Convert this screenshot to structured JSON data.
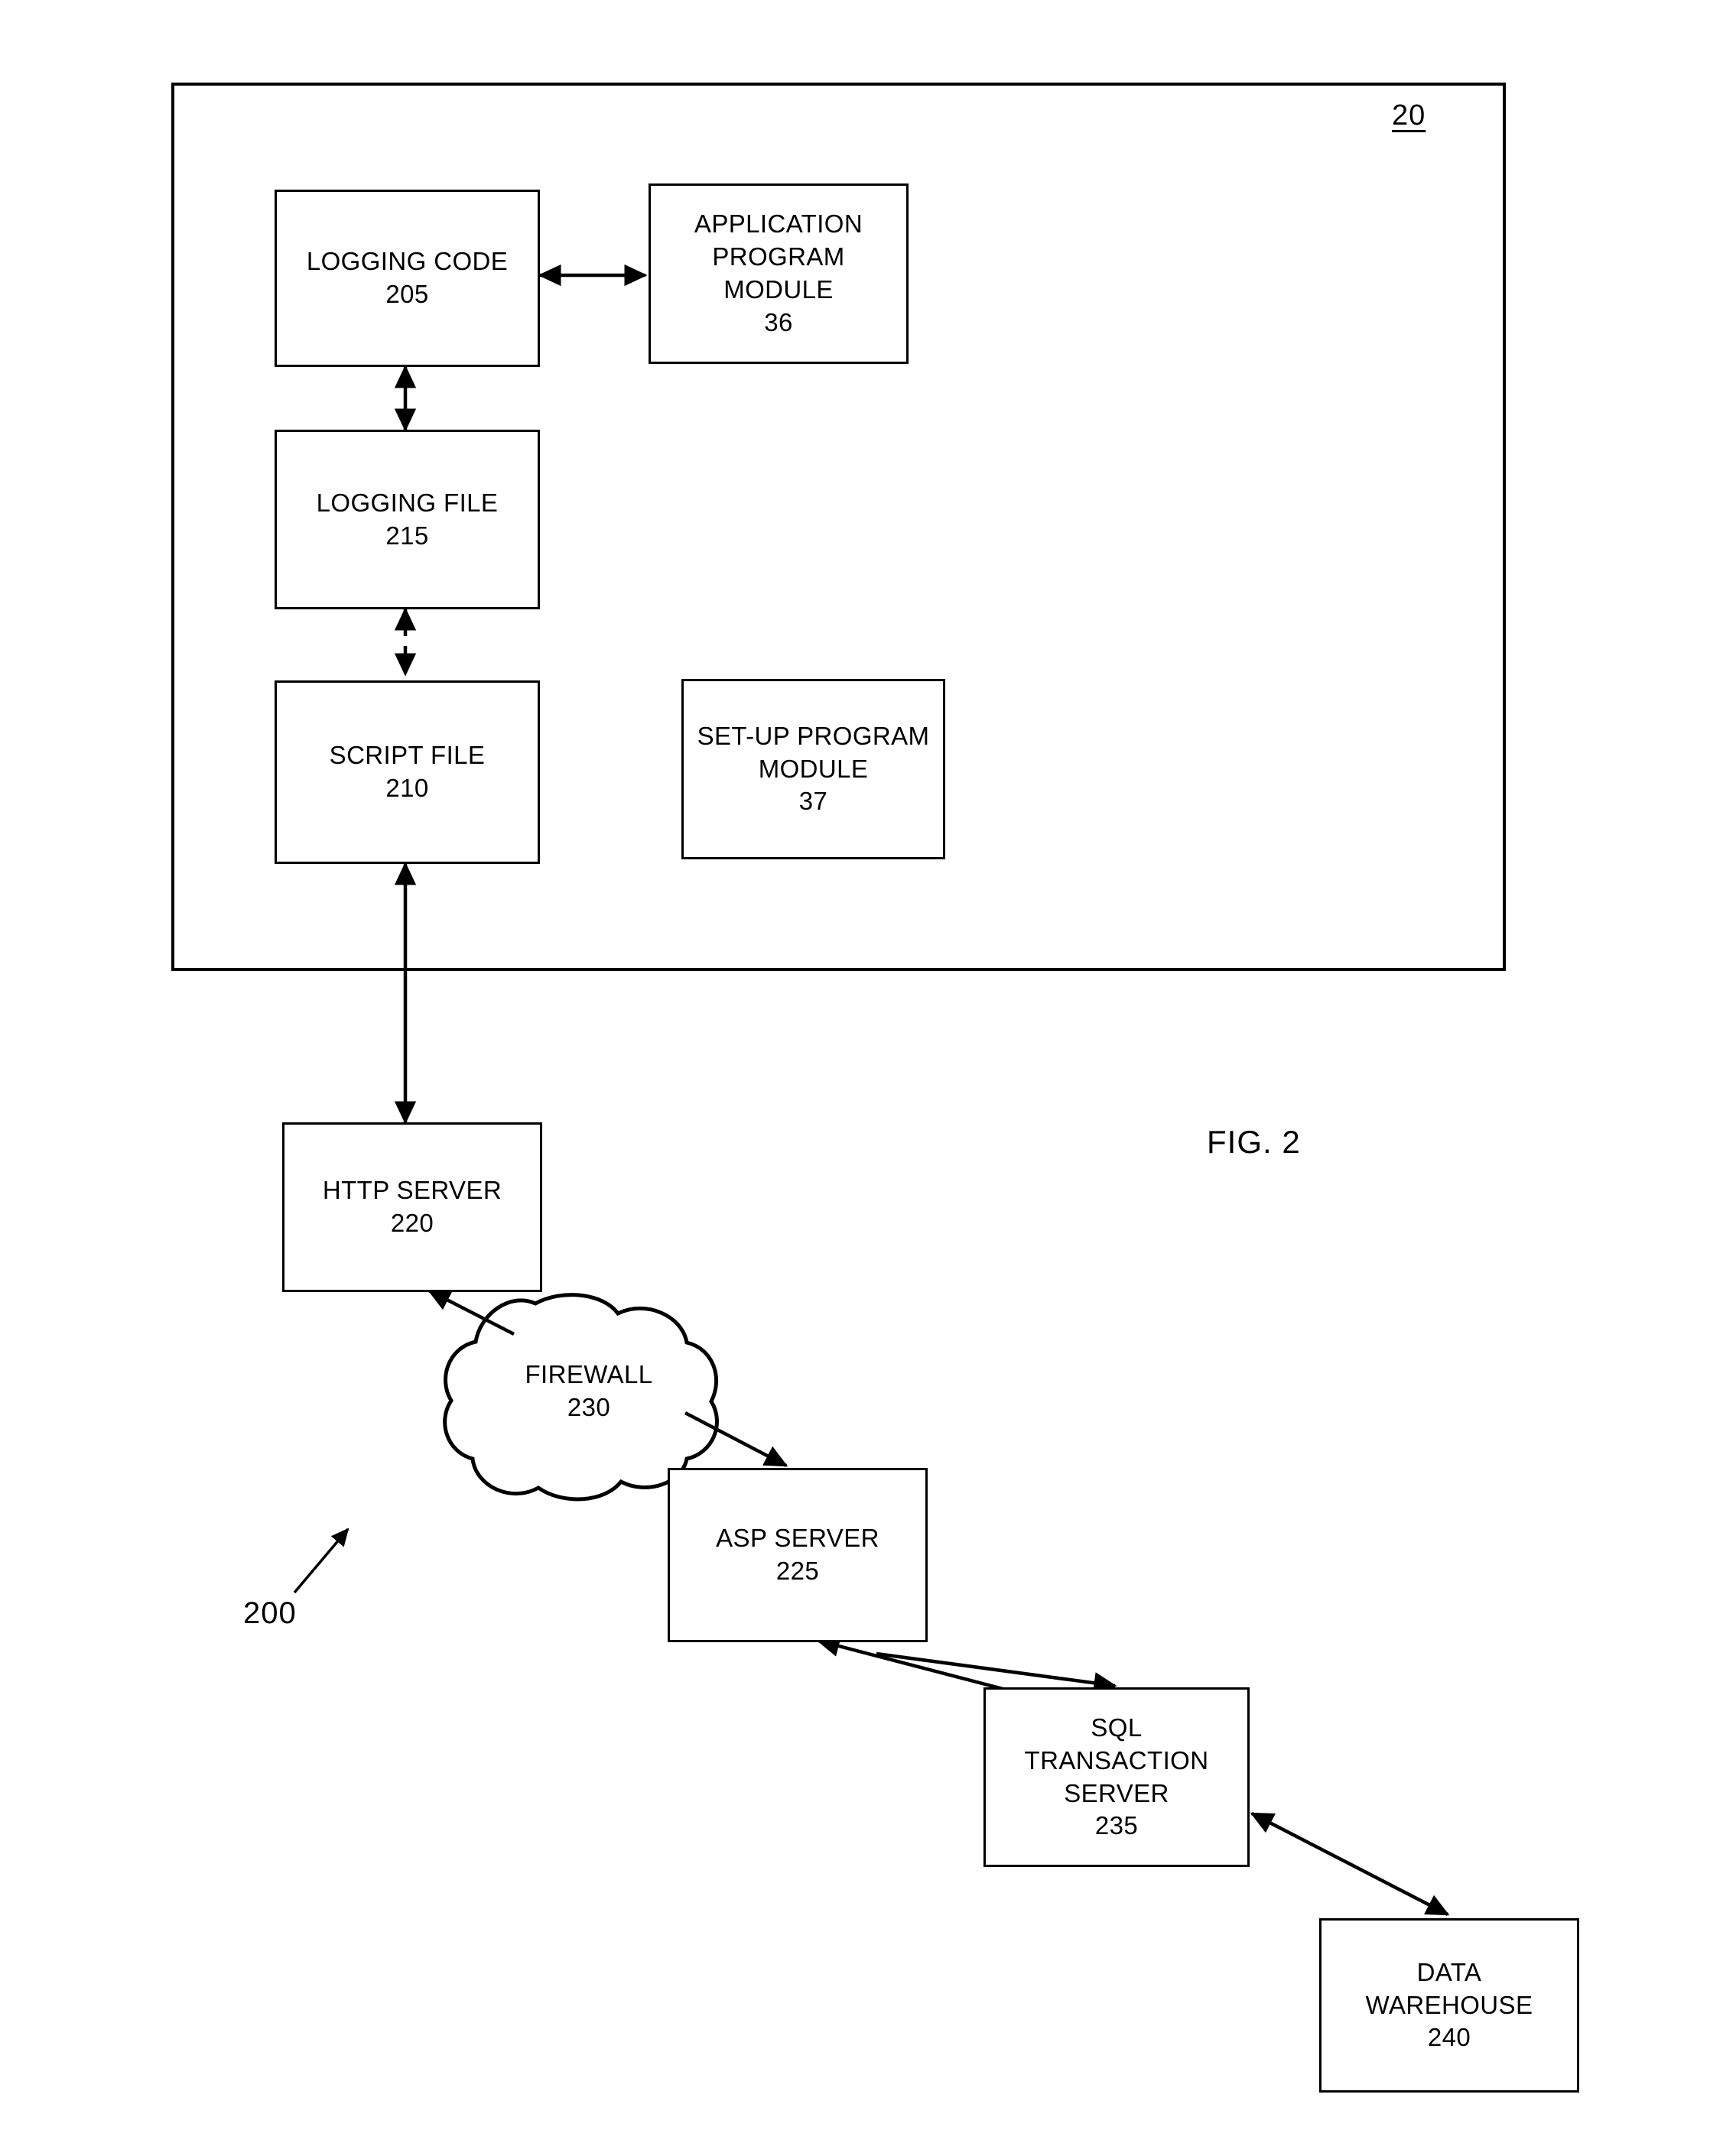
{
  "figure": {
    "caption": "FIG. 2",
    "system_reference": "200",
    "container_reference": "20"
  },
  "nodes": [
    {
      "id": "logging-code",
      "label": "LOGGING CODE",
      "reference": "205",
      "text": "LOGGING CODE\n205",
      "shape": "rectangle"
    },
    {
      "id": "application-program-module",
      "label": "APPLICATION PROGRAM MODULE",
      "reference": "36",
      "text": "APPLICATION\nPROGRAM\nMODULE\n36",
      "shape": "rectangle"
    },
    {
      "id": "logging-file",
      "label": "LOGGING FILE",
      "reference": "215",
      "text": "LOGGING FILE\n215",
      "shape": "rectangle"
    },
    {
      "id": "script-file",
      "label": "SCRIPT FILE",
      "reference": "210",
      "text": "SCRIPT FILE\n210",
      "shape": "rectangle"
    },
    {
      "id": "set-up-program-module",
      "label": "SET-UP PROGRAM MODULE",
      "reference": "37",
      "text": "SET-UP PROGRAM\nMODULE\n37",
      "shape": "rectangle"
    },
    {
      "id": "http-server",
      "label": "HTTP SERVER",
      "reference": "220",
      "text": "HTTP SERVER\n220",
      "shape": "rectangle"
    },
    {
      "id": "firewall",
      "label": "FIREWALL",
      "reference": "230",
      "text": "FIREWALL\n230",
      "shape": "cloud"
    },
    {
      "id": "asp-server",
      "label": "ASP SERVER",
      "reference": "225",
      "text": "ASP SERVER\n225",
      "shape": "rectangle"
    },
    {
      "id": "sql-transaction-server",
      "label": "SQL TRANSACTION SERVER",
      "reference": "235",
      "text": "SQL\nTRANSACTION\nSERVER\n235",
      "shape": "rectangle"
    },
    {
      "id": "data-warehouse",
      "label": "DATA WAREHOUSE",
      "reference": "240",
      "text": "DATA\nWAREHOUSE\n240",
      "shape": "rectangle"
    }
  ],
  "connections": [
    {
      "from": "logging-code",
      "to": "application-program-module",
      "style": "solid",
      "arrows": "both"
    },
    {
      "from": "logging-code",
      "to": "logging-file",
      "style": "solid",
      "arrows": "both"
    },
    {
      "from": "logging-file",
      "to": "script-file",
      "style": "dashed",
      "arrows": "both"
    },
    {
      "from": "script-file",
      "to": "http-server",
      "style": "solid",
      "arrows": "both"
    },
    {
      "from": "firewall",
      "to": "http-server",
      "style": "solid",
      "arrows": "single"
    },
    {
      "from": "firewall",
      "to": "asp-server",
      "style": "solid",
      "arrows": "single"
    },
    {
      "from": "asp-server",
      "to": "sql-transaction-server",
      "style": "solid",
      "arrows": "single"
    },
    {
      "from": "sql-transaction-server",
      "to": "asp-server",
      "style": "solid",
      "arrows": "single"
    },
    {
      "from": "sql-transaction-server",
      "to": "data-warehouse",
      "style": "solid",
      "arrows": "both"
    }
  ],
  "colors": {
    "stroke": "#000000",
    "background": "#ffffff"
  }
}
